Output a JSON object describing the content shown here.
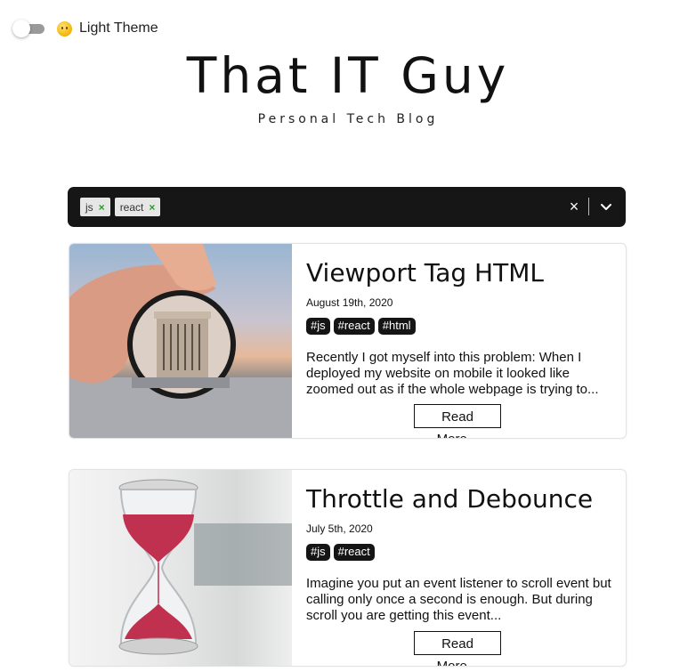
{
  "theme": {
    "label": "Light Theme"
  },
  "site": {
    "title": "That IT Guy",
    "subtitle": "Personal Tech Blog"
  },
  "filter": {
    "selected_tags": [
      {
        "label": "js"
      },
      {
        "label": "react"
      }
    ],
    "clear_glyph": "×"
  },
  "posts": [
    {
      "title": "Viewport Tag HTML",
      "date": "August 19th, 2020",
      "tags": [
        "#js",
        "#react",
        "#html"
      ],
      "excerpt": "Recently I got myself into this problem: When I deployed my website on mobile it looked like zoomed out as if the whole webpage is trying to...",
      "read_more": "Read More..."
    },
    {
      "title": "Throttle and Debounce",
      "date": "July 5th, 2020",
      "tags": [
        "#js",
        "#react"
      ],
      "excerpt": "Imagine you put an event listener to scroll event but calling only once a second is enough. But during scroll you are getting this event...",
      "read_more": "Read More..."
    }
  ],
  "colors": {
    "select_bg": "#161616",
    "tag_bg": "#151515",
    "chip_remove": "#2a9d2a"
  }
}
